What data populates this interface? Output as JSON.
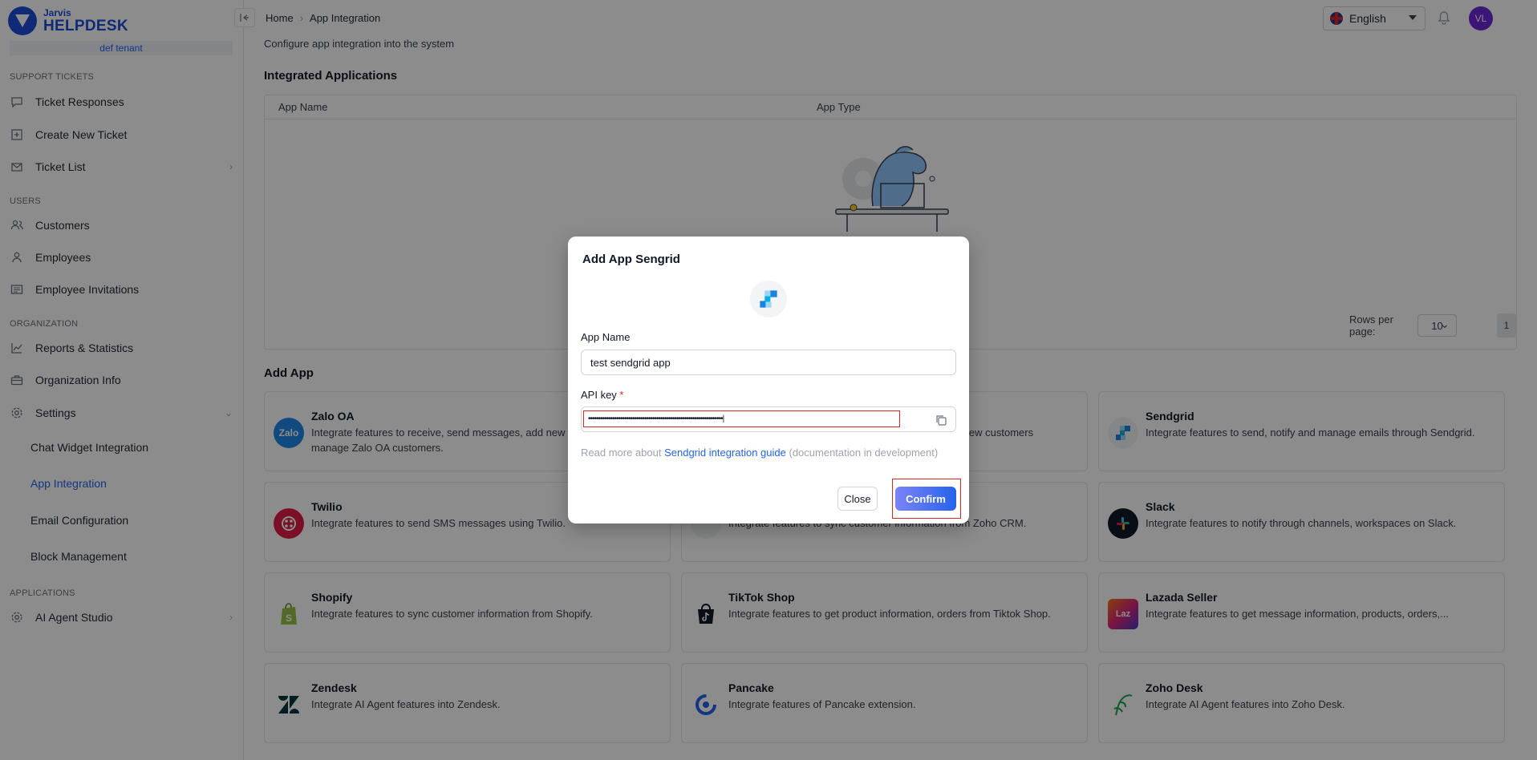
{
  "brand": {
    "line1": "Jarvis",
    "line2": "HELPDESK",
    "tenant": "def tenant"
  },
  "sidebar": {
    "sections": {
      "support": "SUPPORT TICKETS",
      "users": "USERS",
      "organization": "ORGANIZATION",
      "applications": "APPLICATIONS"
    },
    "items": {
      "ticket_responses": "Ticket Responses",
      "create_ticket": "Create New Ticket",
      "ticket_list": "Ticket List",
      "customers": "Customers",
      "employees": "Employees",
      "employee_invitations": "Employee Invitations",
      "reports": "Reports & Statistics",
      "org_info": "Organization Info",
      "settings": "Settings",
      "chat_widget": "Chat Widget Integration",
      "app_integration": "App Integration",
      "email_config": "Email Configuration",
      "block_mgmt": "Block Management",
      "ai_agent_studio": "AI Agent Studio"
    }
  },
  "header": {
    "breadcrumb": {
      "home": "Home",
      "separator": "›",
      "current": "App Integration"
    },
    "language": "English",
    "avatar_initials": "VL"
  },
  "page": {
    "subtitle": "Configure app integration into the system",
    "integrated_title": "Integrated Applications",
    "table": {
      "col_name": "App Name",
      "col_type": "App Type"
    },
    "pager": {
      "rows_label": "Rows per page:",
      "rows_value": "10",
      "page": "1"
    },
    "add_app_title": "Add App"
  },
  "apps": [
    {
      "title": "Zalo OA",
      "desc": "Integrate features to receive, send messages, add new customers and manage Zalo OA customers.",
      "icon_text": "Zalo",
      "icon": "zalo-icon"
    },
    {
      "title": "",
      "desc": "Integrate features to receive, send messages, add new customers",
      "icon_text": "",
      "icon": "app-icon"
    },
    {
      "title": "Sendgrid",
      "desc": "Integrate features to send, notify and manage emails through Sendgrid.",
      "icon_text": "",
      "icon": "sendgrid-icon"
    },
    {
      "title": "Twilio",
      "desc": "Integrate features to send SMS messages using Twilio.",
      "icon_text": "",
      "icon": "twilio-icon"
    },
    {
      "title": "",
      "desc": "Integrate features to sync customer information from Zoho CRM.",
      "icon_text": "",
      "icon": "zoho-crm-icon"
    },
    {
      "title": "Slack",
      "desc": "Integrate features to notify through channels, workspaces on Slack.",
      "icon_text": "",
      "icon": "slack-icon"
    },
    {
      "title": "Shopify",
      "desc": "Integrate features to sync customer information from Shopify.",
      "icon_text": "",
      "icon": "shopify-icon"
    },
    {
      "title": "TikTok Shop",
      "desc": "Integrate features to get product information, orders from Tiktok Shop.",
      "icon_text": "",
      "icon": "tiktok-icon"
    },
    {
      "title": "Lazada Seller",
      "desc": "Integrate features to get message information, products, orders,...",
      "icon_text": "Laz",
      "icon": "lazada-icon"
    },
    {
      "title": "Zendesk",
      "desc": "Integrate AI Agent features into Zendesk.",
      "icon_text": "",
      "icon": "zendesk-icon"
    },
    {
      "title": "Pancake",
      "desc": "Integrate features of Pancake extension.",
      "icon_text": "",
      "icon": "pancake-icon"
    },
    {
      "title": "Zoho Desk",
      "desc": "Integrate AI Agent features into Zoho Desk.",
      "icon_text": "",
      "icon": "zoho-desk-icon"
    }
  ],
  "modal": {
    "title": "Add App Sengrid",
    "app_name_label": "App Name",
    "app_name_value": "test sendgrid app",
    "api_key_label": "API key",
    "api_key_required": "*",
    "api_key_masked": "•••••••••••••••••••••••••••••••••••••••••••••••••••••••••••••••••••|",
    "help_prefix": "Read more about",
    "help_link": "Sendgrid integration guide",
    "help_suffix": "(documentation in development)",
    "close_label": "Close",
    "confirm_label": "Confirm"
  },
  "colors": {
    "accent": "#2563eb",
    "brand": "#1d4ed8",
    "highlight": "#dc2626"
  }
}
